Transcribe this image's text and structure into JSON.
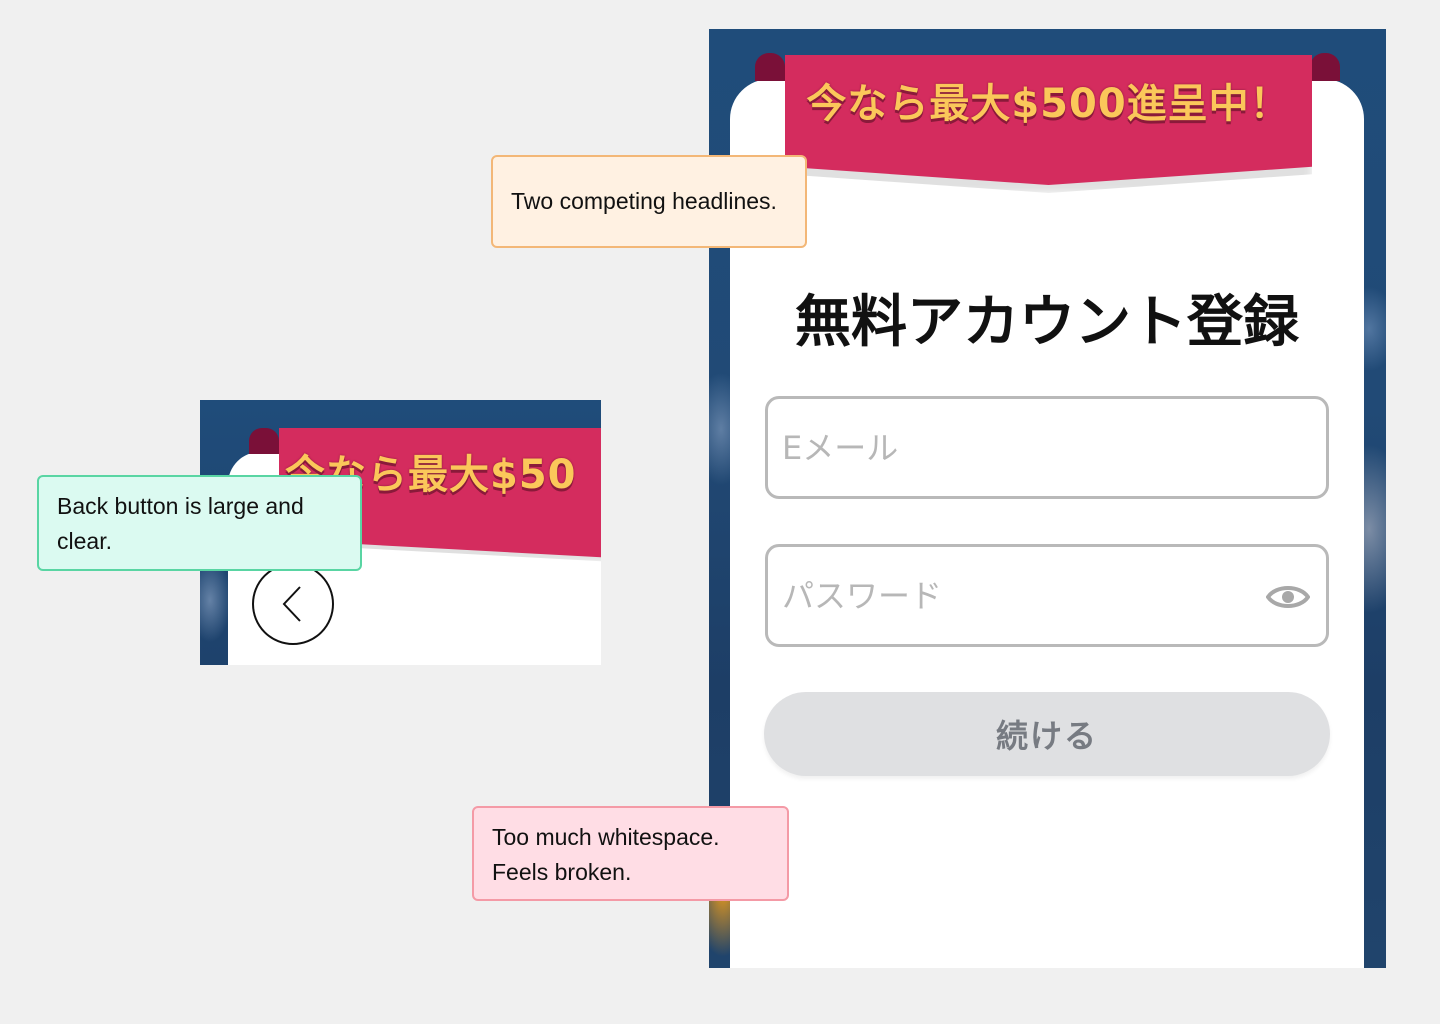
{
  "signup_screen": {
    "promo_banner": "今なら最大$500進呈中！",
    "title": "無料アカウント登録",
    "email_field": {
      "placeholder": "Eメール",
      "value": ""
    },
    "password_field": {
      "placeholder": "パスワード",
      "value": "",
      "toggle_icon": "eye-icon"
    },
    "continue_button": "続ける"
  },
  "back_button_crop": {
    "promo_banner_partial": "今なら最大$50",
    "back_icon": "chevron-left-icon"
  },
  "annotations": [
    {
      "text": "Two competing headlines.",
      "color": "#fff1e2",
      "border": "#f3b777"
    },
    {
      "text": "Back button is large and clear.",
      "color": "#dbfaf1",
      "border": "#59d5a3"
    },
    {
      "text": "Too much whitespace. Feels broken.",
      "color": "#ffdde5",
      "border": "#f49aa6"
    }
  ],
  "colors": {
    "page_background": "#f0f0f0",
    "ribbon": "#d42c5e",
    "promo_text": "#fbc75a",
    "button_disabled": "#dfe0e2",
    "app_background": "#1f4c7a"
  }
}
